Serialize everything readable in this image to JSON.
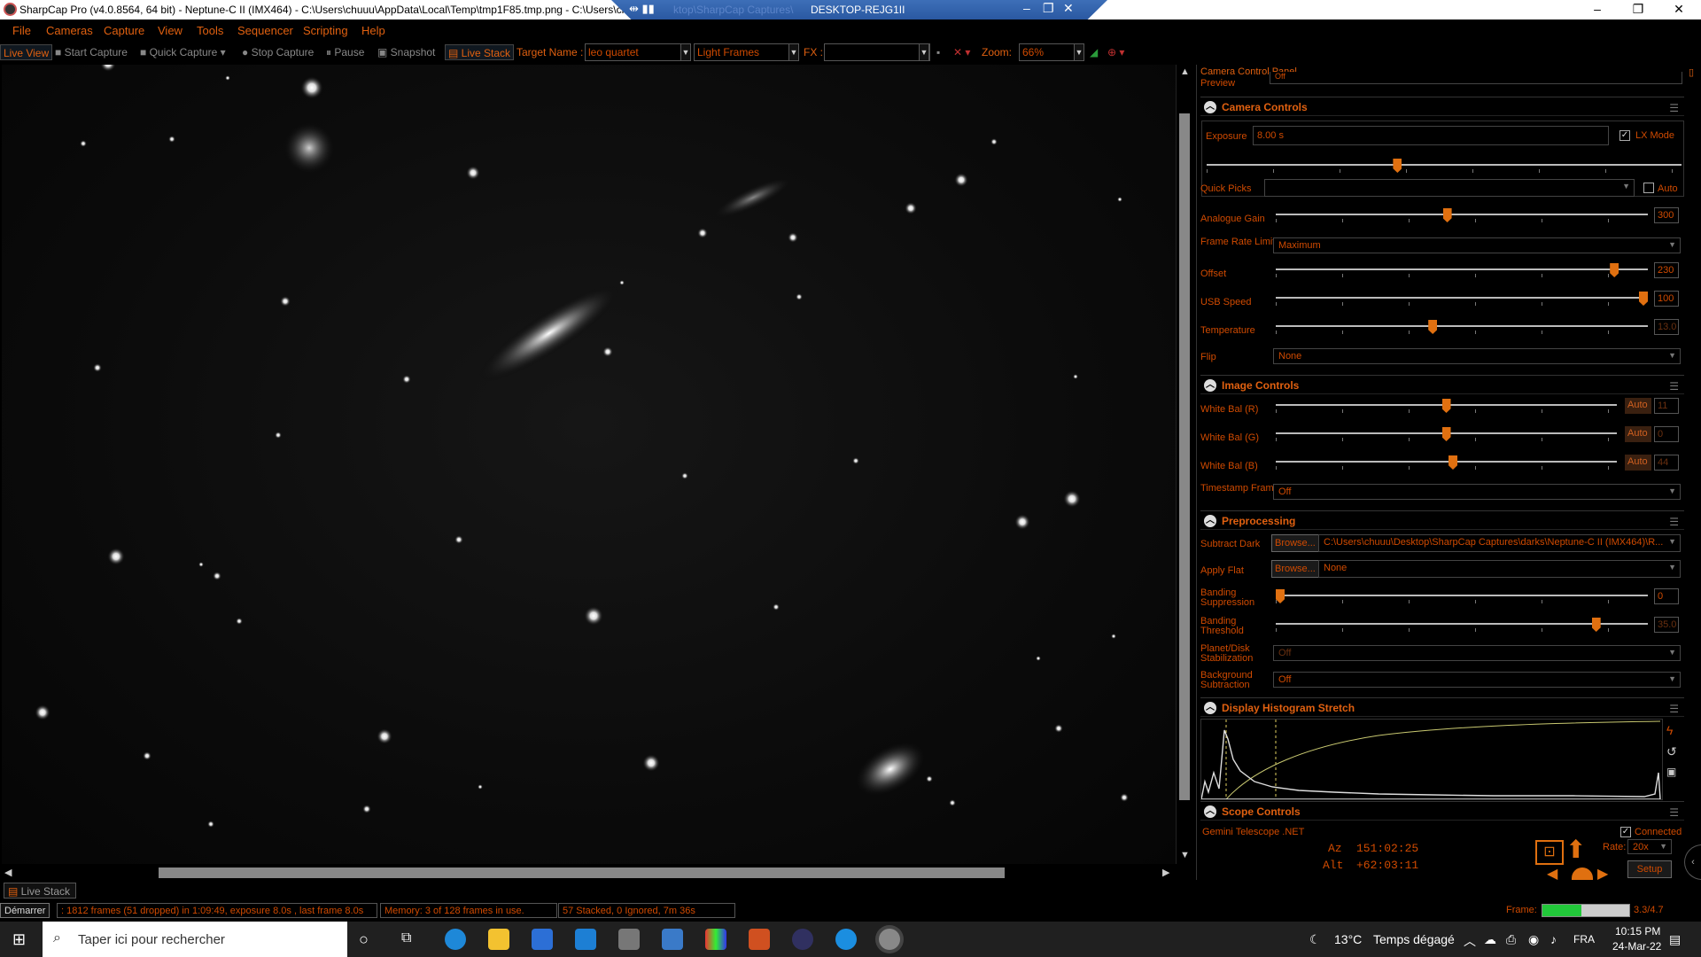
{
  "window": {
    "title": "SharpCap Pro (v4.0.8564, 64 bit) - Neptune-C II (IMX464) - C:\\Users\\chuuu\\AppData\\Local\\Temp\\tmp1F85.tmp.png - C:\\Users\\ch",
    "remote_host": "DESKTOP-REJG1II",
    "remote_ghost_path": "ktop\\SharpCap Captures\\"
  },
  "menu": [
    "File",
    "Cameras",
    "Capture",
    "View",
    "Tools",
    "Sequencer",
    "Scripting",
    "Help"
  ],
  "toolbar": {
    "live_view": "Live View",
    "start_capture": "Start Capture",
    "quick_capture": "Quick Capture",
    "stop_capture": "Stop Capture",
    "pause": "Pause",
    "snapshot": "Snapshot",
    "live_stack": "Live Stack",
    "target_label": "Target Name :",
    "target_value": "leo quartet",
    "frame_type": "Light Frames",
    "fx_label": "FX :",
    "fx_value": "",
    "zoom_label": "Zoom:",
    "zoom_value": "66%"
  },
  "panel": {
    "title": "Camera Control Panel",
    "preview_label": "Preview",
    "preview_value": "Off",
    "camera_controls": {
      "header": "Camera Controls",
      "exposure_label": "Exposure",
      "exposure_value": "8.00 s",
      "lx_mode_label": "LX Mode",
      "lx_mode_checked": true,
      "exposure_position": 0.4,
      "quick_picks_label": "Quick Picks",
      "auto_label": "Auto",
      "analogue_gain_label": "Analogue Gain",
      "analogue_gain_value": "300",
      "analogue_gain_position": 0.46,
      "frame_rate_label": "Frame Rate Limit",
      "frame_rate_value": "Maximum",
      "offset_label": "Offset",
      "offset_value": "230",
      "offset_position": 0.92,
      "usb_speed_label": "USB Speed",
      "usb_speed_value": "100",
      "usb_speed_position": 1.0,
      "temperature_label": "Temperature",
      "temperature_value": "13.0",
      "temperature_position": 0.42,
      "flip_label": "Flip",
      "flip_value": "None"
    },
    "image_controls": {
      "header": "Image Controls",
      "wb_r_label": "White Bal (R)",
      "wb_r_value": "11",
      "wb_r_position": 0.5,
      "wb_g_label": "White Bal (G)",
      "wb_g_value": "0",
      "wb_g_position": 0.5,
      "wb_b_label": "White Bal (B)",
      "wb_b_value": "44",
      "wb_b_position": 0.52,
      "auto_label": "Auto",
      "timestamp_label": "Timestamp Frames",
      "timestamp_value": "Off"
    },
    "preprocessing": {
      "header": "Preprocessing",
      "subtract_dark_label": "Subtract Dark",
      "browse_label": "Browse...",
      "dark_path": "C:\\Users\\chuuu\\Desktop\\SharpCap Captures\\darks\\Neptune-C II (IMX464)\\R...",
      "apply_flat_label": "Apply Flat",
      "flat_value": "None",
      "banding_suppression_label": "Banding Suppression",
      "banding_suppression_value": "0",
      "banding_suppression_position": 0.0,
      "banding_threshold_label": "Banding Threshold",
      "banding_threshold_value": "35.0",
      "banding_threshold_position": 0.87,
      "stabilization_label": "Planet/Disk Stabilization",
      "stabilization_value": "Off",
      "background_label": "Background Subtraction",
      "background_value": "Off"
    },
    "histogram": {
      "header": "Display Histogram Stretch"
    },
    "scope": {
      "header": "Scope Controls",
      "telescope": "Gemini Telescope .NET",
      "connected_label": "Connected",
      "connected_checked": true,
      "az_label": "Az",
      "az_value": "151:02:25",
      "alt_label": "Alt",
      "alt_value": "+62:03:11",
      "rate_label": "Rate:",
      "rate_value": "20x",
      "setup_label": "Setup"
    }
  },
  "status": {
    "tab": "Live Stack",
    "start": "Démarrer",
    "frames": ": 1812 frames (51 dropped) in 1:09:49, exposure 8.0s , last frame 8.0s",
    "memory": "Memory: 3 of 128 frames in use.",
    "stacked": "57 Stacked, 0 Ignored, 7m 36s",
    "frame_label": "Frame:",
    "frame_value": "3.3/4.7",
    "frame_fill": 0.45
  },
  "taskbar": {
    "search_placeholder": "Taper ici pour rechercher",
    "weather_temp": "13°C",
    "weather_text": "Temps dégagé",
    "lang": "FRA",
    "time": "10:15 PM",
    "date": "24-Mar-22"
  },
  "colors": {
    "accent": "#e06010",
    "text_orange": "#d04a00"
  }
}
